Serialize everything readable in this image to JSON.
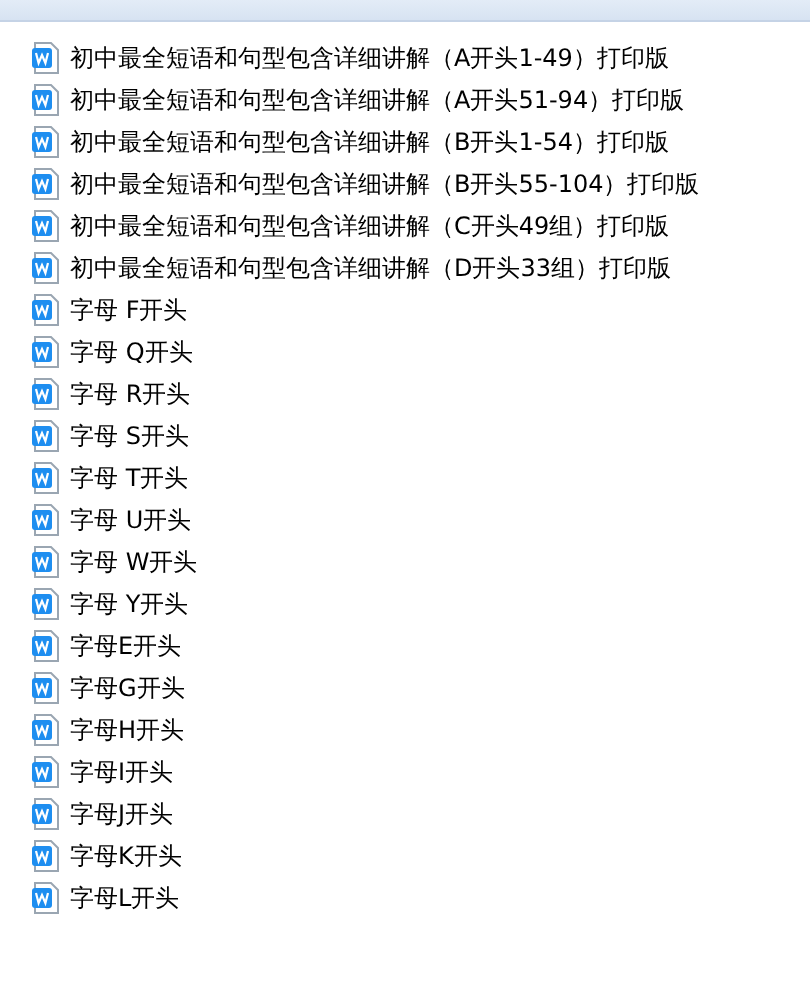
{
  "files": [
    {
      "name": "初中最全短语和句型包含详细讲解（A开头1-49）打印版"
    },
    {
      "name": "初中最全短语和句型包含详细讲解（A开头51-94）打印版"
    },
    {
      "name": "初中最全短语和句型包含详细讲解（B开头1-54）打印版"
    },
    {
      "name": "初中最全短语和句型包含详细讲解（B开头55-104）打印版"
    },
    {
      "name": "初中最全短语和句型包含详细讲解（C开头49组）打印版"
    },
    {
      "name": "初中最全短语和句型包含详细讲解（D开头33组）打印版"
    },
    {
      "name": "字母 F开头"
    },
    {
      "name": "字母 Q开头"
    },
    {
      "name": "字母 R开头"
    },
    {
      "name": "字母 S开头"
    },
    {
      "name": "字母 T开头"
    },
    {
      "name": "字母 U开头"
    },
    {
      "name": "字母 W开头"
    },
    {
      "name": "字母 Y开头"
    },
    {
      "name": "字母E开头"
    },
    {
      "name": "字母G开头"
    },
    {
      "name": "字母H开头"
    },
    {
      "name": "字母I开头"
    },
    {
      "name": "字母J开头"
    },
    {
      "name": "字母K开头"
    },
    {
      "name": "字母L开头"
    }
  ]
}
